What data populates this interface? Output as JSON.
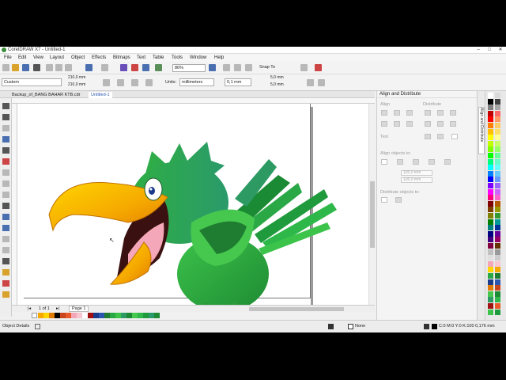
{
  "window": {
    "title": "CorelDRAW X7 - Untitled-1",
    "controls": [
      "–",
      "□",
      "✕"
    ]
  },
  "menu": [
    "File",
    "Edit",
    "View",
    "Layout",
    "Object",
    "Effects",
    "Bitmaps",
    "Text",
    "Table",
    "Tools",
    "Window",
    "Help"
  ],
  "toolbar": {
    "zoom": "86%",
    "snap_to": "Snap To"
  },
  "property_bar": {
    "page_size": "Custom",
    "width": "210,0 mm",
    "height": "210,0 mm",
    "units_label": "Units:",
    "units_value": "millimeters",
    "nudge": "0,1 mm",
    "dup_x": "5,0 mm",
    "dup_y": "5,0 mm"
  },
  "doc_tabs": [
    "Backup_of_BANG BAHAR KTB.cdr",
    "Untitled-1"
  ],
  "page_nav": {
    "counter": "1 of 1",
    "page_tab": "Page 1"
  },
  "status": {
    "object_details": "Object Details",
    "fill": "None",
    "outline": "C:0 M:0 Y:0 K:100  0,176 mm"
  },
  "docker": {
    "title": "Align and Distribute",
    "align": "Align",
    "distribute": "Distribute",
    "text": "Text",
    "align_objects_to": "Align objects to:",
    "x_field": "105,0 mm",
    "y_field": "105,0 mm",
    "distribute_objects_to": "Distribute objects to:",
    "vertical_tab": "Align and Distribute"
  },
  "colors": {
    "canvas_bg": "#ffffff",
    "parrot_green": "#28a745",
    "beak": "#f5a800"
  }
}
